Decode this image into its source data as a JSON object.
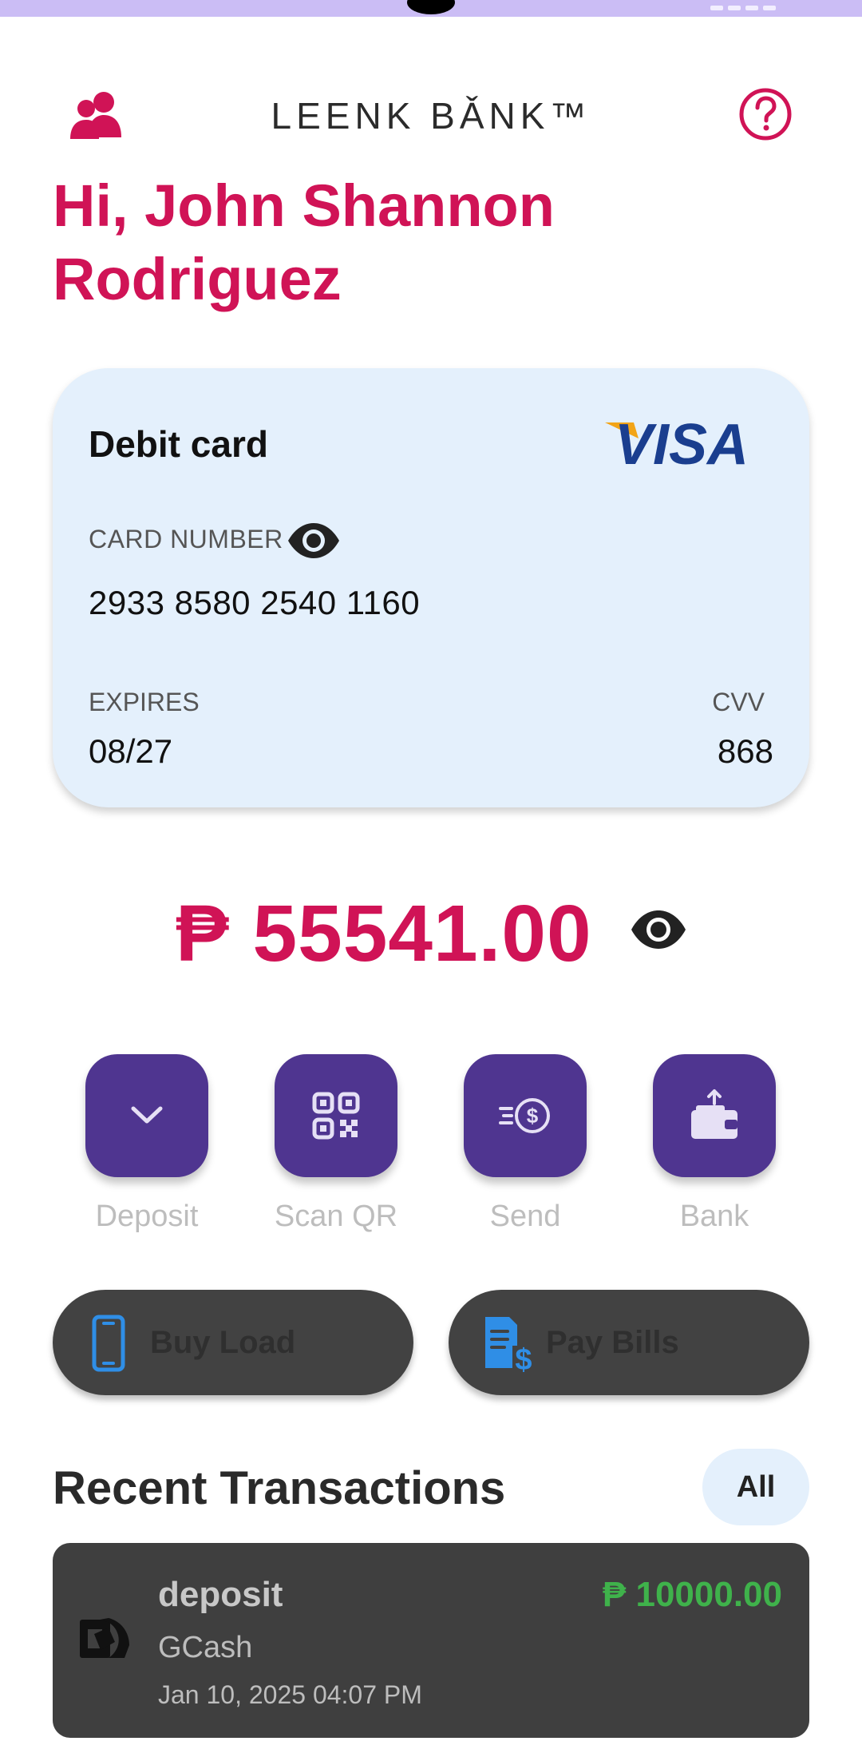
{
  "header": {
    "brand": "LEENK BǍNK™",
    "people_icon": "people-icon",
    "help_icon": "help-circle-icon"
  },
  "greeting": "Hi, John Shannon Rodriguez",
  "card": {
    "title": "Debit card",
    "brand_logo": "VISA",
    "number_label": "CARD NUMBER",
    "number": "2933 8580 2540 1160",
    "expires_label": "EXPIRES",
    "expires": "08/27",
    "cvv_label": "CVV",
    "cvv": "868"
  },
  "balance": {
    "amount": "₱ 55541.00",
    "visibility_icon": "eye-icon"
  },
  "actions": [
    {
      "label": "Deposit",
      "icon": "chevron-down-icon"
    },
    {
      "label": "Scan QR",
      "icon": "qr-code-icon"
    },
    {
      "label": "Send",
      "icon": "send-money-icon"
    },
    {
      "label": "Bank",
      "icon": "wallet-icon"
    }
  ],
  "quick_actions": [
    {
      "label": "Buy Load",
      "icon": "phone-icon"
    },
    {
      "label": "Pay Bills",
      "icon": "bill-icon"
    }
  ],
  "recent": {
    "title": "Recent Transactions",
    "all_label": "All",
    "transactions": [
      {
        "type": "deposit",
        "source": "GCash",
        "date": "Jan 10, 2025 04:07 PM",
        "amount": "₱ 10000.00"
      }
    ]
  },
  "colors": {
    "accent": "#d01356",
    "action_purple": "#4f3590",
    "card_bg": "#e4f0fc",
    "status_bar": "#cbbdf5",
    "positive": "#3fb24b"
  }
}
